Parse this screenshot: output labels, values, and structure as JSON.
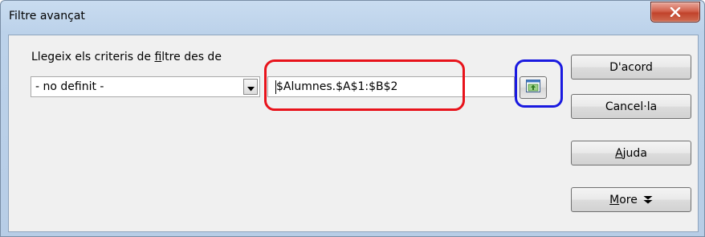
{
  "window": {
    "title": "Filtre avançat"
  },
  "criteria": {
    "label_pre": "Llegeix els criteris de ",
    "label_mnemonic": "f",
    "label_post": "iltre des de",
    "source_selected": "- no definit -",
    "range_value": "$Alumnes.$A$1:$B$2"
  },
  "buttons": {
    "ok": "D'acord",
    "cancel": "Cancel·la",
    "help_mnemonic": "A",
    "help_rest": "juda",
    "more_mnemonic": "M",
    "more_rest": "ore"
  },
  "icons": {
    "close": "close-icon",
    "combo_arrow": "chevron-down-icon",
    "shrink": "shrink-dialog-icon",
    "more": "double-chevron-down-icon"
  },
  "colors": {
    "highlight_range": "#e8131b",
    "highlight_shrink": "#1a1ae0",
    "close_button": "#c1432c"
  }
}
